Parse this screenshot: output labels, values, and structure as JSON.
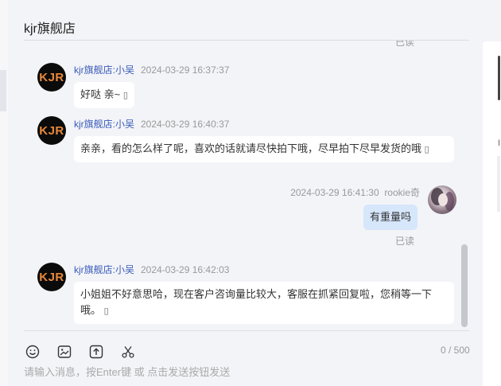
{
  "shop": {
    "title": "kjr旗舰店",
    "avatar_text": "KJR"
  },
  "messages": [
    {
      "read_label": "已读"
    },
    {
      "sender": "kjr旗舰店:小吴",
      "time": "2024-03-29 16:37:37",
      "text": "好哒  亲~ ",
      "emoji": "▯"
    },
    {
      "sender": "kjr旗舰店:小吴",
      "time": "2024-03-29 16:40:37",
      "text": "亲亲，看的怎么样了呢，喜欢的话就请尽快拍下哦，尽早拍下尽早发货的哦",
      "emoji": "▯"
    },
    {
      "sender": "rookie奇",
      "time": "2024-03-29 16:41:30",
      "text": "有重量吗",
      "read_label": "已读"
    },
    {
      "sender": "kjr旗舰店:小吴",
      "time": "2024-03-29 16:42:03",
      "text": "小姐姐不好意思哈，现在客户咨询量比较大，客服在抓紧回复啦，您稍等一下哦。 ",
      "emoji": "▯"
    }
  ],
  "composer": {
    "counter": "0 / 500",
    "placeholder": "请输入消息，按Enter键 或 点击发送按钮发送",
    "tools": [
      "emoji-icon",
      "image-icon",
      "upload-icon",
      "scissors-icon"
    ]
  },
  "side_panel": {
    "glyph": "I"
  },
  "colors": {
    "name": "#3a5bb8",
    "self_bubble": "#d6e6fb",
    "avatar_bg": "#0b0b0b",
    "avatar_text": "#e8883a"
  }
}
